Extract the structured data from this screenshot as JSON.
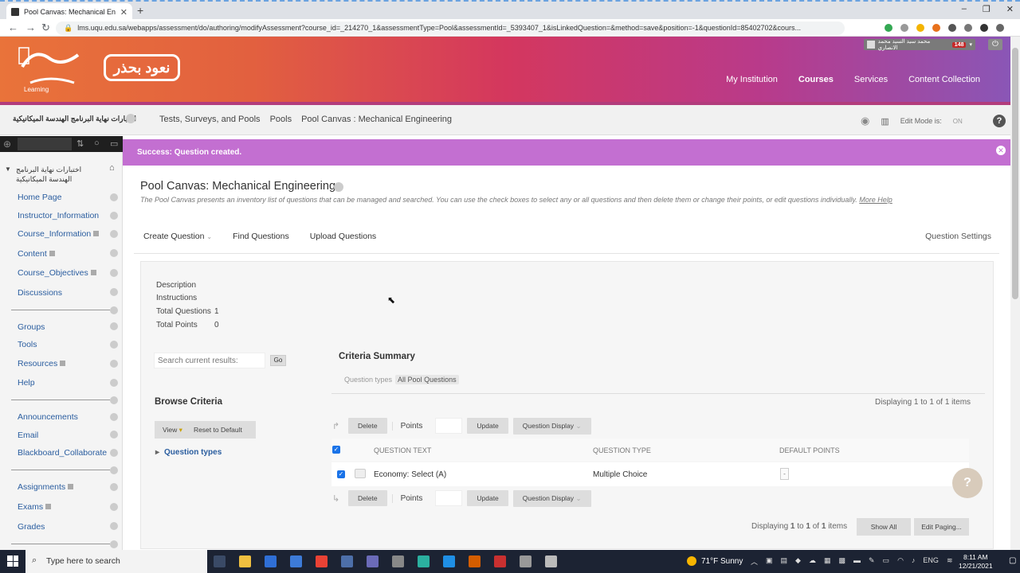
{
  "browser": {
    "tab_title": "Pool Canvas: Mechanical Engineer",
    "url": "lms.uqu.edu.sa/webapps/assessment/do/authoring/modifyAssessment?course_id=_214270_1&assessmentType=Pool&assessmentId=_5393407_1&isLinkedQuestion=&method=save&position=-1&questionId=85402702&cours..."
  },
  "header": {
    "logo_text": "نعود بحذر",
    "logo_learning": "Learning",
    "user_badge": "148",
    "user_name": "محمد سيد السيد محمد الانصاري",
    "nav": [
      "My Institution",
      "Courses",
      "Services",
      "Content Collection"
    ]
  },
  "crumbbar": {
    "course_title": "اختبارات نهاية البرنامج الهندسة الميكانيكية",
    "crumbs": [
      "Tests, Surveys, and Pools",
      "Pools",
      "Pool Canvas : Mechanical Engineering"
    ],
    "edit_mode_label": "Edit Mode is:",
    "edit_mode_value": "ON",
    "help": "?"
  },
  "sidebar": {
    "course_title": "اختبارات نهاية البرنامج الهندسة الميكانيكية",
    "items": [
      {
        "label": "Home Page"
      },
      {
        "label": "Instructor_Information"
      },
      {
        "label": "Course_Information"
      },
      {
        "label": "Content"
      },
      {
        "label": "Course_Objectives"
      },
      {
        "label": "Discussions"
      },
      {
        "label": "Groups"
      },
      {
        "label": "Tools"
      },
      {
        "label": "Resources"
      },
      {
        "label": "Help"
      },
      {
        "label": "Announcements"
      },
      {
        "label": "Email"
      },
      {
        "label": "Blackboard_Collaborate"
      },
      {
        "label": "Assignments"
      },
      {
        "label": "Exams"
      },
      {
        "label": "Grades"
      }
    ]
  },
  "main": {
    "success_message": "Success: Question created.",
    "page_title": "Pool Canvas: Mechanical Engineering",
    "page_desc": "The Pool Canvas presents an inventory list of questions that can be managed and searched. You can use the check boxes to select any or all questions and then delete them or change their points, or edit questions individually.",
    "more_help": "More Help",
    "actions": [
      "Create Question",
      "Find Questions",
      "Upload Questions"
    ],
    "question_settings": "Question Settings",
    "meta": {
      "description_label": "Description",
      "instructions_label": "Instructions",
      "total_questions_label": "Total Questions",
      "total_questions_value": "1",
      "total_points_label": "Total Points",
      "total_points_value": "0"
    },
    "search_placeholder": "Search current results:",
    "go_label": "Go",
    "browse_title": "Browse Criteria",
    "view_label": "View",
    "reset_label": "Reset to Default",
    "question_types_label": "Question types",
    "criteria_title": "Criteria Summary",
    "criteria_key": "Question types",
    "criteria_value": "All Pool Questions",
    "displaying_top": "Displaying 1 to 1 of 1 items",
    "toolbar": {
      "delete": "Delete",
      "points": "Points",
      "update": "Update",
      "question_display": "Question Display"
    },
    "table_headers": [
      "QUESTION TEXT",
      "QUESTION TYPE",
      "DEFAULT POINTS"
    ],
    "rows": [
      {
        "text": "Economy: Select (A)",
        "type": "Multiple Choice",
        "points": "-"
      }
    ],
    "displaying_bottom_prefix": "Displaying",
    "displaying_bottom_from": "1",
    "displaying_bottom_to_word": "to",
    "displaying_bottom_to": "1",
    "displaying_bottom_of_word": "of",
    "displaying_bottom_total": "1",
    "displaying_bottom_suffix": "items",
    "show_all": "Show All",
    "edit_paging": "Edit Paging..."
  },
  "taskbar": {
    "search_placeholder": "Type here to search",
    "weather": "71°F  Sunny",
    "lang": "ENG",
    "time": "8:11 AM",
    "date": "12/21/2021"
  }
}
